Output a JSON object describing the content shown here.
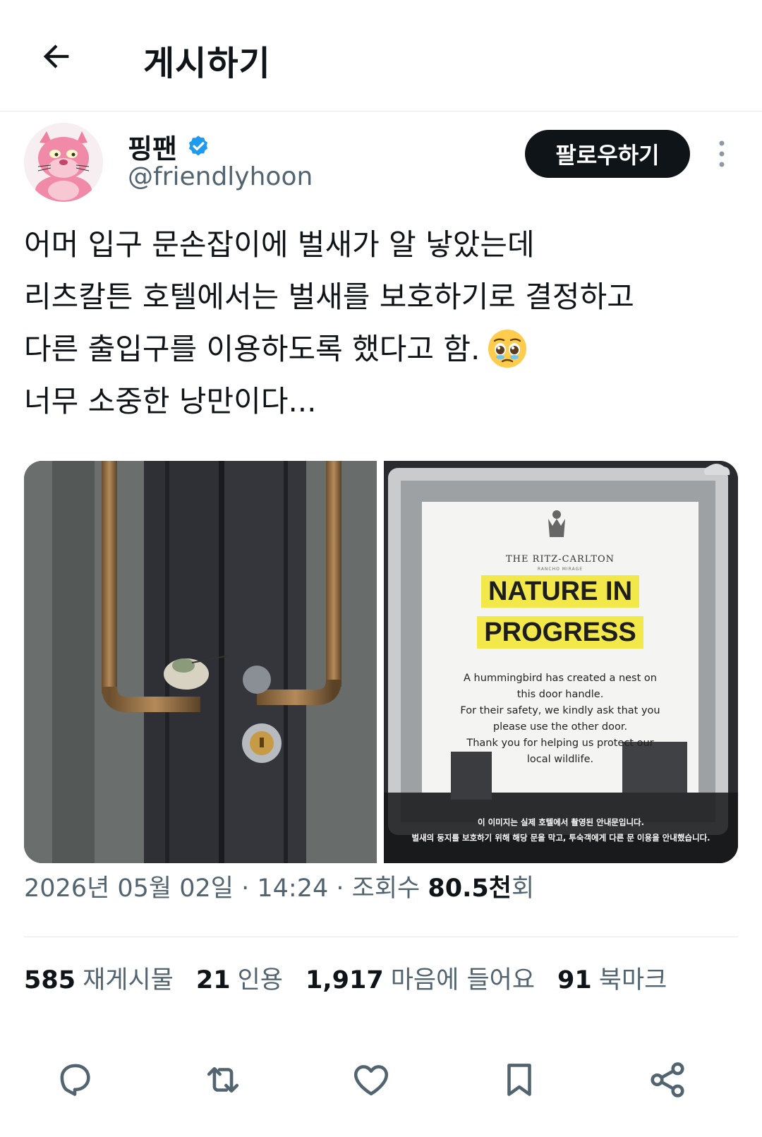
{
  "header": {
    "title": "게시하기",
    "back_icon": "arrow-left-icon"
  },
  "author": {
    "display_name": "핑팬",
    "handle": "@friendlyhoon",
    "verified": true,
    "follow_label": "팔로우하기",
    "more_icon": "more-vertical-icon"
  },
  "post": {
    "lines": [
      "어머 입구 문손잡이에 벌새가 알 낳았는데",
      "리츠칼튼 호텔에서는 벌새를 보호하기로 결정하고",
      "다른 출입구를 이용하도록 했다고 함.",
      "너무 소중한 낭만이다..."
    ],
    "emoji": "pleading-face-emoji"
  },
  "media": {
    "left_image": "door-handle-hummingbird-nest-photo",
    "right_image": {
      "brand": "THE RITZ-CARLTON",
      "brand_sub": "RANCHO MIRAGE",
      "headline_1": "NATURE IN",
      "headline_2": "PROGRESS",
      "body_lines": [
        "A hummingbird has created a nest on",
        "this door handle.",
        "For their safety, we kindly ask that you",
        "please use the other door.",
        "Thank you for helping us protect our",
        "local wildlife."
      ],
      "caption_1": "이 이미지는 실제 호텔에서 촬영된 안내문입니다.",
      "caption_2": "벌새의 둥지를 보호하기 위해 해당 문을 막고, 투숙객에게 다른 문 이용을 안내했습니다."
    }
  },
  "meta": {
    "date": "2026년 05월 02일",
    "sep1": " · ",
    "time": "14:24",
    "sep2": " · ",
    "views_label": "조회수 ",
    "views_value": "80.5천",
    "views_suffix": "회"
  },
  "stats": [
    {
      "num": "585",
      "label": "재게시물"
    },
    {
      "num": "21",
      "label": "인용"
    },
    {
      "num": "1,917",
      "label": "마음에 들어요"
    },
    {
      "num": "91",
      "label": "북마크"
    }
  ],
  "actions": {
    "reply_icon": "reply-icon",
    "repost_icon": "repost-icon",
    "like_icon": "heart-icon",
    "bookmark_icon": "bookmark-icon",
    "share_icon": "share-icon"
  },
  "colors": {
    "text_primary": "#0f1419",
    "text_secondary": "#536471",
    "verified_blue": "#1d9bf0",
    "follow_bg": "#0f1419",
    "sign_highlight": "#f3e84a"
  }
}
